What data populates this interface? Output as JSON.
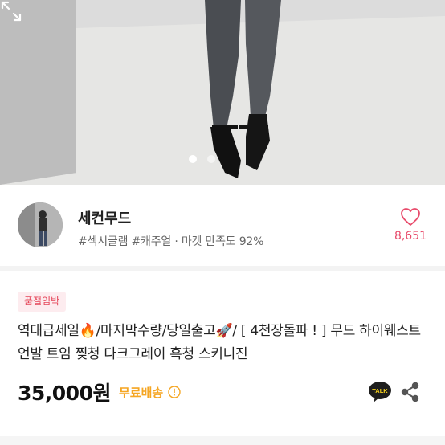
{
  "gallery": {
    "image_alt": "product photo",
    "slide_count": 2,
    "active_slide": 1
  },
  "seller": {
    "name": "세컨무드",
    "tags": "#섹시글램 #캐주얼 · 마켓 만족도 92%",
    "likes": "8,651"
  },
  "product": {
    "badge": "품절임박",
    "title": "역대급세일🔥/마지막수량/당일출고🚀/ [ 4천장돌파 ! ] 무드 하이웨스트 언발 트임 찢청 다크그레이 흑청 스키니진",
    "price": "35,000원",
    "shipping": "무료배송"
  },
  "actions": {
    "talk_label": "TALK"
  },
  "colors": {
    "like": "#e84c6c",
    "badge_bg": "#fdecef",
    "badge_text": "#e5475a",
    "shipping": "#f5a623"
  }
}
